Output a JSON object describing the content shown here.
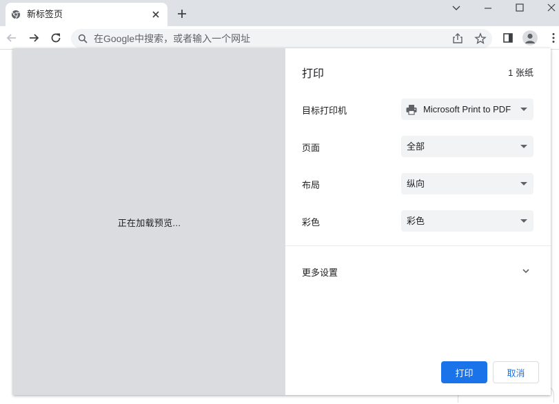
{
  "browser": {
    "tab": {
      "title": "新标签页",
      "favicon": "chrome-icon"
    },
    "window_controls": [
      "chevron-down-icon",
      "minimize-icon",
      "maximize-icon",
      "close-icon"
    ],
    "omnibox": {
      "placeholder": "在Google中搜索，或者输入一个网址"
    },
    "accent": "#1a73e8"
  },
  "print_dialog": {
    "preview_text": "正在加载预览...",
    "title": "打印",
    "sheet_count": "1 张纸",
    "destination": {
      "label": "目标打印机",
      "value": "Microsoft Print to PDF",
      "icon": "printer-icon"
    },
    "pages": {
      "label": "页面",
      "value": "全部"
    },
    "layout": {
      "label": "布局",
      "value": "纵向"
    },
    "color": {
      "label": "彩色",
      "value": "彩色"
    },
    "more_settings": "更多设置",
    "print_button": "打印",
    "cancel_button": "取消"
  }
}
